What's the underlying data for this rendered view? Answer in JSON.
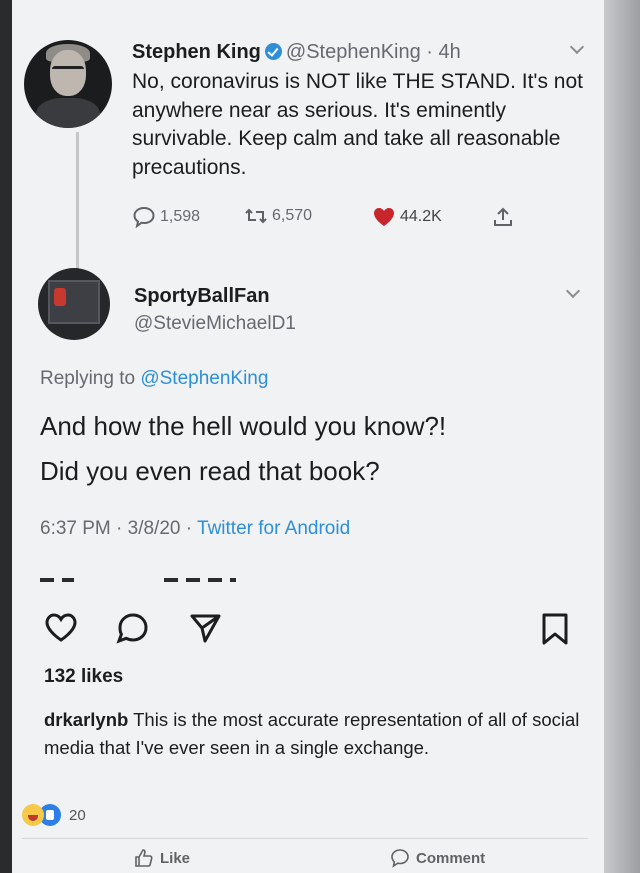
{
  "tweet": {
    "author_name": "Stephen King",
    "author_handle": "@StephenKing",
    "time": "· 4h",
    "text": "No, coronavirus is NOT like THE STAND. It's not anywhere near as serious. It's eminently survivable. Keep calm and take all reasonable precautions.",
    "replies": "1,598",
    "retweets": "6,570",
    "likes": "44.2K"
  },
  "reply": {
    "author_name": "SportyBallFan",
    "author_handle": "@StevieMichaelD1",
    "replying_label": "Replying to ",
    "replying_to": "@StephenKing",
    "line1": "And how the hell would you know?!",
    "line2": "Did you even read that book?",
    "timestamp": "6:37 PM · 3/8/20 · ",
    "source": "Twitter for Android"
  },
  "post": {
    "likes_count": "132 likes",
    "caption_user": "drkarlynb",
    "caption_text": " This is the most accurate representation of all of social media that I've ever seen in a single exchange."
  },
  "facebook": {
    "reaction_count": "20",
    "like_label": "Like",
    "comment_label": "Comment"
  },
  "colors": {
    "link_blue": "#2d8fd8",
    "like_heart_red": "#c8252c"
  }
}
